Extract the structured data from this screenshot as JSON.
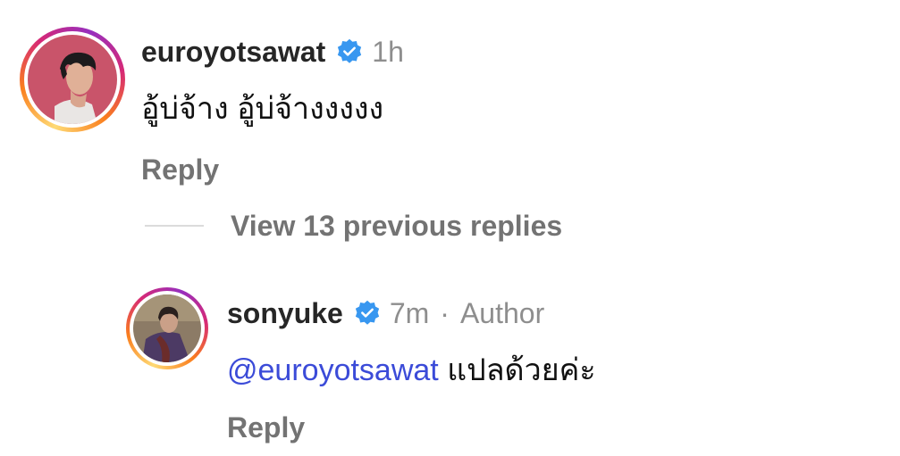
{
  "comments": [
    {
      "username": "euroyotsawat",
      "verified": true,
      "time": "1h",
      "text": "อู้บ่จ้าง อู้บ่จ้างงงงง",
      "reply_label": "Reply",
      "avatar_icon": "user-photo-avatar"
    }
  ],
  "view_replies": {
    "label": "View 13 previous replies"
  },
  "replies": [
    {
      "username": "sonyuke",
      "verified": true,
      "time": "7m",
      "separator": "·",
      "badge": "Author",
      "mention": "@euroyotsawat",
      "text": " แปลด้วยค่ะ",
      "reply_label": "Reply",
      "avatar_icon": "user-photo-avatar"
    }
  ],
  "colors": {
    "mention": "#3b4bd8",
    "verified": "#3897f0",
    "muted": "#8e8e8e"
  }
}
